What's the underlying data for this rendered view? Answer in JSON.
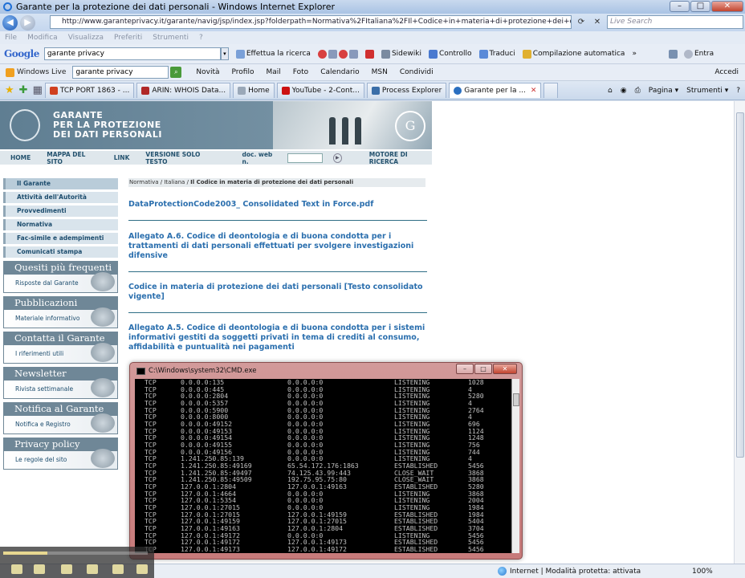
{
  "window": {
    "title": "Garante per la protezione dei dati personali - Windows Internet Explorer",
    "btn_min": "–",
    "btn_max": "□",
    "btn_close": "✕"
  },
  "address": {
    "url": "http://www.garanteprivacy.it/garante/navig/jsp/index.jsp?folderpath=Normativa%2FItaliana%2FIl+Codice+in+materia+di+protezione+dei+dati+personali",
    "live_search_placeholder": "Live Search"
  },
  "menu": [
    "File",
    "Modifica",
    "Visualizza",
    "Preferiti",
    "Strumenti",
    "?"
  ],
  "google_toolbar": {
    "logo": "Google",
    "query": "garante privacy",
    "search_btn": "Effettua la ricerca",
    "sidewiki": "Sidewiki",
    "controllo": "Controllo",
    "traduci": "Traduci",
    "compilazione": "Compilazione automatica",
    "more": "»",
    "entra": "Entra"
  },
  "live_toolbar": {
    "brand": "Windows Live",
    "query": "garante privacy",
    "links": [
      "Novità",
      "Profilo",
      "Mail",
      "Foto",
      "Calendario",
      "MSN",
      "Condividi"
    ],
    "accedi": "Accedi"
  },
  "tabs": [
    {
      "label": "TCP PORT 1863 - ...",
      "color": "#d04020"
    },
    {
      "label": "ARIN: WHOIS Data...",
      "color": "#b02828"
    },
    {
      "label": "Home",
      "color": "#9aa8b8"
    },
    {
      "label": "YouTube - 2-Cont...",
      "color": "#cc1010"
    },
    {
      "label": "Process Explorer",
      "color": "#3a6ea8"
    },
    {
      "label": "Garante per la ...",
      "color": "#2a6fc0",
      "active": true
    }
  ],
  "tab_tools": {
    "pagina": "Pagina ▾",
    "strumenti": "Strumenti ▾"
  },
  "site": {
    "title_line1": "GARANTE",
    "title_line2": "PER LA PROTEZIONE",
    "title_line3": "DEI DATI PERSONALI",
    "logo_text": "G",
    "nav": {
      "home": "HOME",
      "mappa": "MAPPA DEL SITO",
      "link": "LINK",
      "solo_testo": "VERSIONE SOLO TESTO",
      "docweb": "doc. web n.",
      "motore": "MOTORE DI RICERCA"
    }
  },
  "sidebar": {
    "items": [
      "Il Garante",
      "Attività dell'Autorità",
      "Provvedimenti",
      "Normativa",
      "Fac-simile e adempimenti",
      "Comunicati stampa"
    ],
    "boxes": [
      {
        "header": "Quesiti più frequenti",
        "sub": "Risposte dal Garante"
      },
      {
        "header": "Pubblicazioni",
        "sub": "Materiale informativo"
      },
      {
        "header": "Contatta il Garante",
        "sub": "I riferimenti utili"
      },
      {
        "header": "Newsletter",
        "sub": "Rivista settimanale"
      },
      {
        "header": "Notifica al Garante",
        "sub": "Notifica e Registro"
      },
      {
        "header": "Privacy policy",
        "sub": "Le regole del sito"
      }
    ]
  },
  "breadcrumb": {
    "part1": "Normativa",
    "sep": " / ",
    "part2": "Italiana",
    "part3": "Il Codice in materia di protezione dei dati personali"
  },
  "documents": [
    {
      "title": "DataProtectionCode2003_ Consolidated Text in Force.pdf"
    },
    {
      "title": "Allegato A.6. Codice di deontologia e di buona condotta per i trattamenti di dati personali effettuati per svolgere investigazioni difensive"
    },
    {
      "title": "Codice in materia di protezione dei dati personali [Testo consolidato vigente]"
    },
    {
      "title": "Allegato A.5. Codice di deontologia e di buona condotta per i sistemi informativi gestiti da soggetti privati in tema di crediti al consumo, affidabilità e puntualità nei pagamenti"
    }
  ],
  "cmd": {
    "title": "C:\\Windows\\system32\\CMD.exe",
    "rows": [
      [
        "TCP",
        "0.0.0.0:135",
        "0.0.0.0:0",
        "LISTENING",
        "1028"
      ],
      [
        "TCP",
        "0.0.0.0:445",
        "0.0.0.0:0",
        "LISTENING",
        "4"
      ],
      [
        "TCP",
        "0.0.0.0:2804",
        "0.0.0.0:0",
        "LISTENING",
        "5280"
      ],
      [
        "TCP",
        "0.0.0.0:5357",
        "0.0.0.0:0",
        "LISTENING",
        "4"
      ],
      [
        "TCP",
        "0.0.0.0:5900",
        "0.0.0.0:0",
        "LISTENING",
        "2764"
      ],
      [
        "TCP",
        "0.0.0.0:8000",
        "0.0.0.0:0",
        "LISTENING",
        "4"
      ],
      [
        "TCP",
        "0.0.0.0:49152",
        "0.0.0.0:0",
        "LISTENING",
        "696"
      ],
      [
        "TCP",
        "0.0.0.0:49153",
        "0.0.0.0:0",
        "LISTENING",
        "1124"
      ],
      [
        "TCP",
        "0.0.0.0:49154",
        "0.0.0.0:0",
        "LISTENING",
        "1248"
      ],
      [
        "TCP",
        "0.0.0.0:49155",
        "0.0.0.0:0",
        "LISTENING",
        "756"
      ],
      [
        "TCP",
        "0.0.0.0:49156",
        "0.0.0.0:0",
        "LISTENING",
        "744"
      ],
      [
        "TCP",
        "1.241.250.85:139",
        "0.0.0.0:0",
        "LISTENING",
        "4"
      ],
      [
        "TCP",
        "1.241.250.85:49169",
        "65.54.172.176:1863",
        "ESTABLISHED",
        "5456"
      ],
      [
        "TCP",
        "1.241.250.85:49497",
        "74.125.43.99:443",
        "CLOSE_WAIT",
        "3868"
      ],
      [
        "TCP",
        "1.241.250.85:49509",
        "192.75.95.75:80",
        "CLOSE_WAIT",
        "3868"
      ],
      [
        "TCP",
        "127.0.0.1:2804",
        "127.0.0.1:49163",
        "ESTABLISHED",
        "5280"
      ],
      [
        "TCP",
        "127.0.0.1:4664",
        "0.0.0.0:0",
        "LISTENING",
        "3868"
      ],
      [
        "TCP",
        "127.0.0.1:5354",
        "0.0.0.0:0",
        "LISTENING",
        "2004"
      ],
      [
        "TCP",
        "127.0.0.1:27015",
        "0.0.0.0:0",
        "LISTENING",
        "1984"
      ],
      [
        "TCP",
        "127.0.0.1:27015",
        "127.0.0.1:49159",
        "ESTABLISHED",
        "1984"
      ],
      [
        "TCP",
        "127.0.0.1:49159",
        "127.0.0.1:27015",
        "ESTABLISHED",
        "5404"
      ],
      [
        "TCP",
        "127.0.0.1:49163",
        "127.0.0.1:2804",
        "ESTABLISHED",
        "3704"
      ],
      [
        "TCP",
        "127.0.0.1:49172",
        "0.0.0.0:0",
        "LISTENING",
        "5456"
      ],
      [
        "TCP",
        "127.0.0.1:49172",
        "127.0.0.1:49173",
        "ESTABLISHED",
        "5456"
      ],
      [
        "TCP",
        "127.0.0.1:49173",
        "127.0.0.1:49172",
        "ESTABLISHED",
        "5456"
      ]
    ]
  },
  "status": {
    "text": "Internet | Modalità protetta: attivata",
    "zoom": "100%"
  }
}
